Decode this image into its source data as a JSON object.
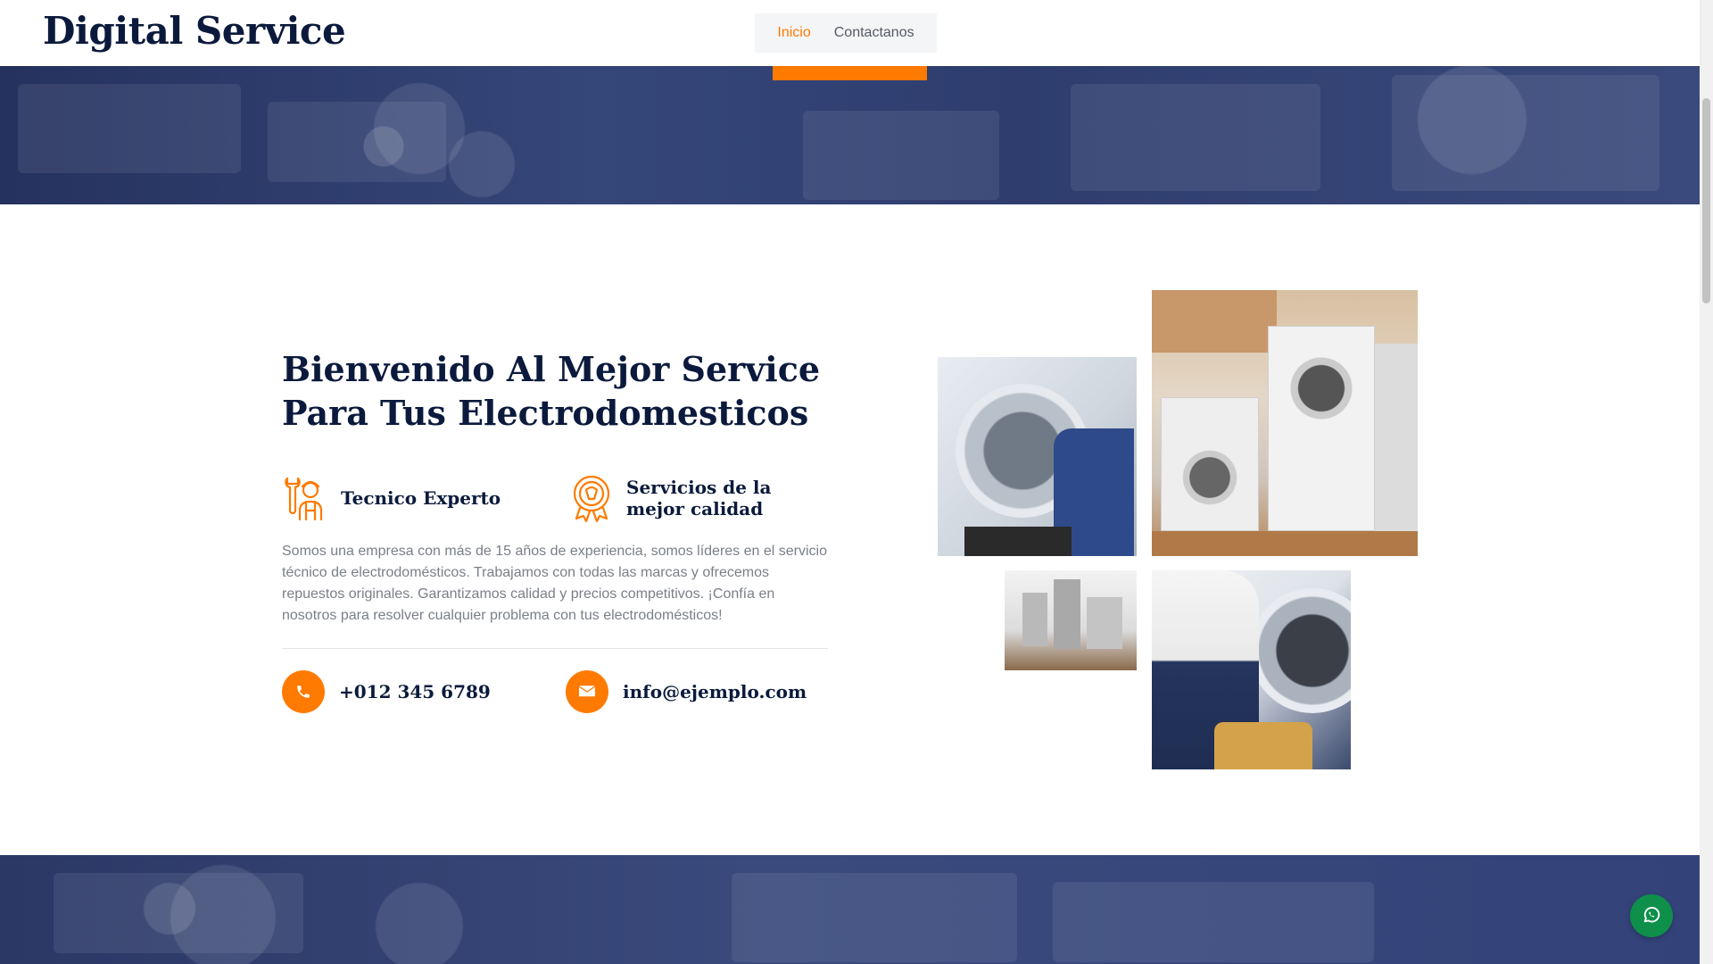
{
  "brand": {
    "name": "Digital Service"
  },
  "nav": {
    "items": [
      {
        "label": "Inicio",
        "active": true
      },
      {
        "label": "Contactanos",
        "active": false
      }
    ]
  },
  "about": {
    "headline_line1": "Bienvenido Al Mejor Service",
    "headline_line2": "Para Tus Electrodomesticos",
    "features": [
      {
        "icon": "technician-icon",
        "title": "Tecnico Experto"
      },
      {
        "icon": "quality-award-icon",
        "title": "Servicios de la mejor calidad"
      }
    ],
    "description": "Somos una empresa con más de 15 años de experiencia, somos líderes en el servicio técnico de electrodomésticos. Trabajamos con todas las marcas y ofrecemos repuestos originales. Garantizamos calidad y precios competitivos. ¡Confía en nosotros para resolver cualquier problema con tus electrodomésticos!",
    "contacts": {
      "phone": {
        "icon": "phone-icon",
        "text": "+012 345 6789"
      },
      "email": {
        "icon": "envelope-icon",
        "text": "info@ejemplo.com"
      }
    }
  },
  "colors": {
    "accent": "#ff7a00",
    "heading": "#0b1a3c",
    "hero_overlay": "#2e3d6e",
    "whatsapp": "#0e8f4a"
  },
  "floating": {
    "whatsapp_icon": "whatsapp-icon"
  }
}
